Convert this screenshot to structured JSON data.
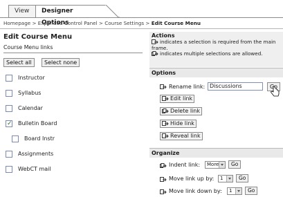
{
  "tabs": [
    {
      "label": "View"
    },
    {
      "label": "Designer Options"
    }
  ],
  "breadcrumb": {
    "homepage": "Homepage",
    "expanded": "Expanded Control Panel",
    "course_settings": "Course Settings",
    "current": "Edit Course Menu"
  },
  "page": {
    "title": "Edit Course Menu",
    "subtitle": "Course Menu links",
    "select_all": "Select all",
    "select_none": "Select none"
  },
  "menu_items": [
    {
      "label": "Instructor",
      "checked": false
    },
    {
      "label": "Syllabus",
      "checked": false
    },
    {
      "label": "Calendar",
      "checked": false
    },
    {
      "label": "Bulletin Board",
      "checked": true
    },
    {
      "label": "Board Instr",
      "checked": false
    },
    {
      "label": "Assignments",
      "checked": false
    },
    {
      "label": "WebCT mail",
      "checked": false
    }
  ],
  "actions": {
    "title": "Actions",
    "line1": "indicates a selection is required from the main frame.",
    "line2": "indicates multiple selections are allowed."
  },
  "options": {
    "title": "Options",
    "rename_label": "Rename link:",
    "rename_value": "Discussions",
    "go": "Go",
    "edit": "Edit link",
    "delete": "Delete link",
    "hide": "Hide link",
    "reveal": "Reveal link"
  },
  "organize": {
    "title": "Organize",
    "indent_label": "Indent link:",
    "indent_value": "More",
    "move_up_label": "Move link up by:",
    "move_up_value": "1",
    "move_down_label": "Move link down by:",
    "move_down_value": "1",
    "go": "Go"
  }
}
